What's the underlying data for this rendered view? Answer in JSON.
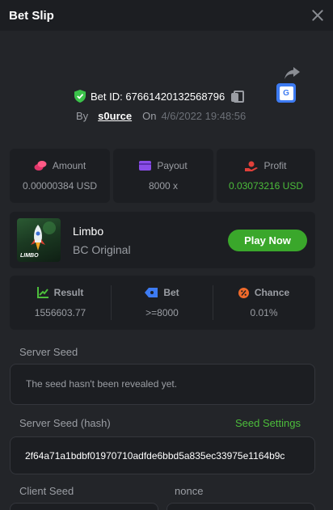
{
  "header": {
    "title": "Bet Slip"
  },
  "bet": {
    "id_label": "Bet ID: 67661420132568796",
    "by_label": "By",
    "user": "s0urce",
    "on_label": "On",
    "date": "4/6/2022 19:48:56"
  },
  "stats": {
    "amount": {
      "label": "Amount",
      "value": "0.00000384 USD"
    },
    "payout": {
      "label": "Payout",
      "value": "8000 x"
    },
    "profit": {
      "label": "Profit",
      "value": "0.03073216 USD"
    }
  },
  "game": {
    "name": "Limbo",
    "subtitle": "BC Original",
    "thumb_label": "LIMBO",
    "play_label": "Play Now"
  },
  "result": {
    "result": {
      "label": "Result",
      "value": "1556603.77"
    },
    "bet": {
      "label": "Bet",
      "value": ">=8000"
    },
    "chance": {
      "label": "Chance",
      "value": "0.01%"
    }
  },
  "seeds": {
    "server_seed_label": "Server Seed",
    "server_seed_value": "The seed hasn't been revealed yet.",
    "server_hash_label": "Server Seed (hash)",
    "seed_settings_label": "Seed Settings",
    "server_hash_value": "2f64a71a1bdbf01970710adfde6bbd5a835ec33975e1164b9c",
    "client_seed_label": "Client Seed",
    "nonce_label": "nonce"
  },
  "colors": {
    "background": "#232529",
    "card": "#1c1e22",
    "accent_green": "#3aa72b",
    "profit_green": "#4cbd3b",
    "muted_text": "#9b9ea4"
  },
  "icons": {
    "close": "close-icon",
    "share": "share-icon",
    "translate": "translate-icon",
    "verified": "shield-check-icon",
    "copy": "copy-icon",
    "amount": "coins-icon",
    "payout": "wallet-icon",
    "profit": "hand-coin-icon",
    "result": "chart-up-icon",
    "bet": "ticket-icon",
    "chance": "percent-icon"
  }
}
